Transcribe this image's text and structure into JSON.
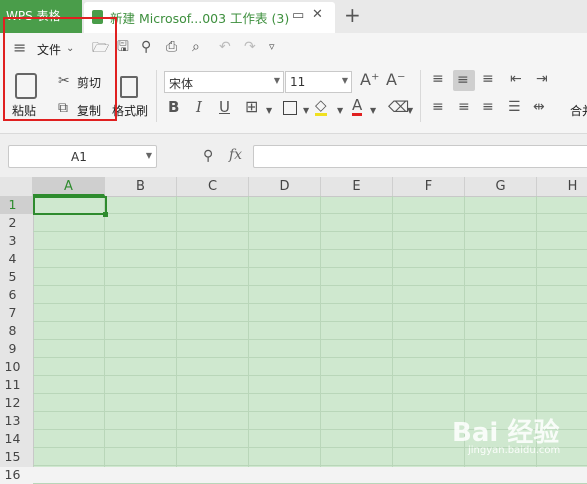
{
  "tabs": {
    "app": "WPS 表格",
    "doc_title": "新建 Microsof...003 工作表 (3)"
  },
  "toolbar": {
    "file_menu": "文件"
  },
  "ribbon": {
    "paste": "粘贴",
    "cut": "剪切",
    "copy": "复制",
    "format_painter": "格式刷",
    "font_name": "宋体",
    "font_size": "11",
    "merge": "合并"
  },
  "formula_bar": {
    "cell_ref": "A1",
    "fx": "fx"
  },
  "grid": {
    "columns": [
      "A",
      "B",
      "C",
      "D",
      "E",
      "F",
      "G",
      "H"
    ],
    "rows": [
      "1",
      "2",
      "3",
      "4",
      "5",
      "6",
      "7",
      "8",
      "9",
      "10",
      "11",
      "12",
      "13",
      "14",
      "15",
      "16"
    ]
  },
  "watermark": {
    "logo": "Bai 经验",
    "url": "jingyan.baidu.com"
  },
  "colors": {
    "accent": "#4a9d4a",
    "highlight": "#e02020",
    "grid_bg": "#cfe8cf"
  }
}
